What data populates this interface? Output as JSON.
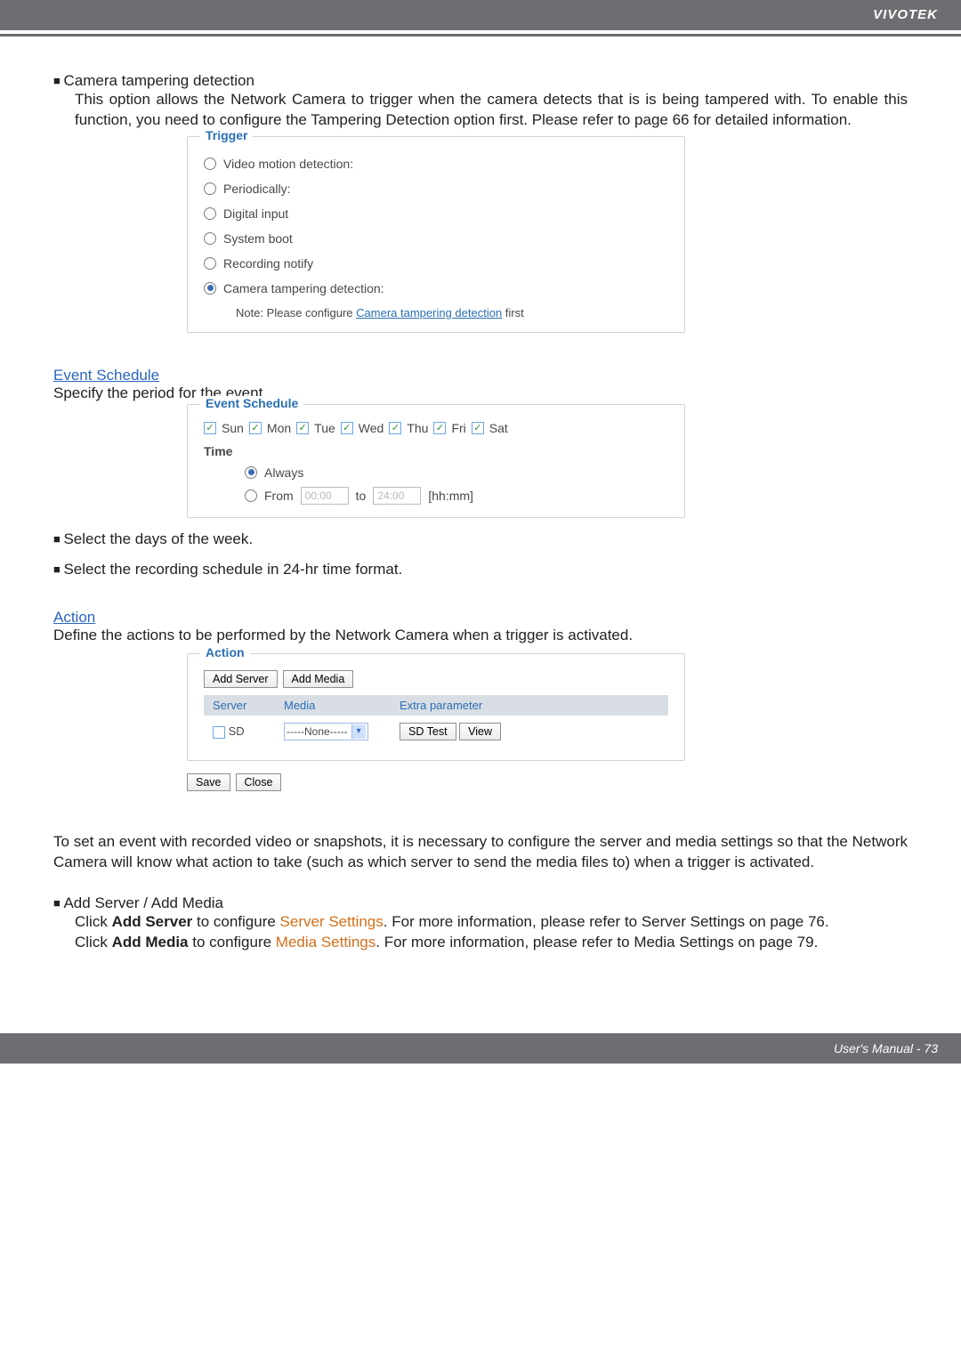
{
  "header": {
    "brand": "VIVOTEK"
  },
  "section_tamper": {
    "title": "Camera tampering detection",
    "body": "This option allows the Network Camera to trigger when the camera detects that is is being tampered with. To enable this function, you need to configure the Tampering Detection option first. Please refer to page 66 for detailed information."
  },
  "trigger_panel": {
    "legend": "Trigger",
    "opts": [
      "Video motion detection:",
      "Periodically:",
      "Digital input",
      "System boot",
      "Recording notify",
      "Camera tampering detection:"
    ],
    "note_prefix": "Note: Please configure ",
    "note_link": "Camera tampering detection",
    "note_suffix": " first"
  },
  "schedule": {
    "heading": "Event Schedule",
    "intro": "Specify the period for the event.",
    "legend": "Event Schedule",
    "days": [
      "Sun",
      "Mon",
      "Tue",
      "Wed",
      "Thu",
      "Fri",
      "Sat"
    ],
    "time_label": "Time",
    "always": "Always",
    "from_label": "From",
    "from_val": "00:00",
    "to_word": "to",
    "to_val": "24:00",
    "hhmm": "[hh:mm]"
  },
  "schedule_bullets": {
    "b1": "Select the days of the week.",
    "b2": "Select the recording schedule in 24-hr time format."
  },
  "action": {
    "heading": "Action",
    "intro": "Define the actions to be performed by the Network Camera when a trigger is activated.",
    "legend": "Action",
    "add_server": "Add Server",
    "add_media": "Add Media",
    "th_server": "Server",
    "th_media": "Media",
    "th_extra": "Extra parameter",
    "row_server": "SD",
    "row_media_sel": "-----None-----",
    "row_btn_sd": "SD Test",
    "row_btn_view": "View",
    "save": "Save",
    "close": "Close"
  },
  "cfg_para": "To set an event with recorded video or snapshots, it is necessary to configure the server and media settings so that the Network Camera will know what action to take (such as which server to send the media files to) when a trigger is activated.",
  "add_media_section": {
    "title": "Add Server / Add Media",
    "l1a": "Click ",
    "l1b": "Add Server",
    "l1c": " to configure ",
    "l1d": "Server Settings",
    "l1e": ". For more information, please refer to Server Settings on page 76.",
    "l2a": "Click ",
    "l2b": "Add Media",
    "l2c": " to configure ",
    "l2d": "Media Settings",
    "l2e": ". For more information, please refer to Media Settings on page 79."
  },
  "footer": {
    "text": "User's Manual - 73"
  }
}
